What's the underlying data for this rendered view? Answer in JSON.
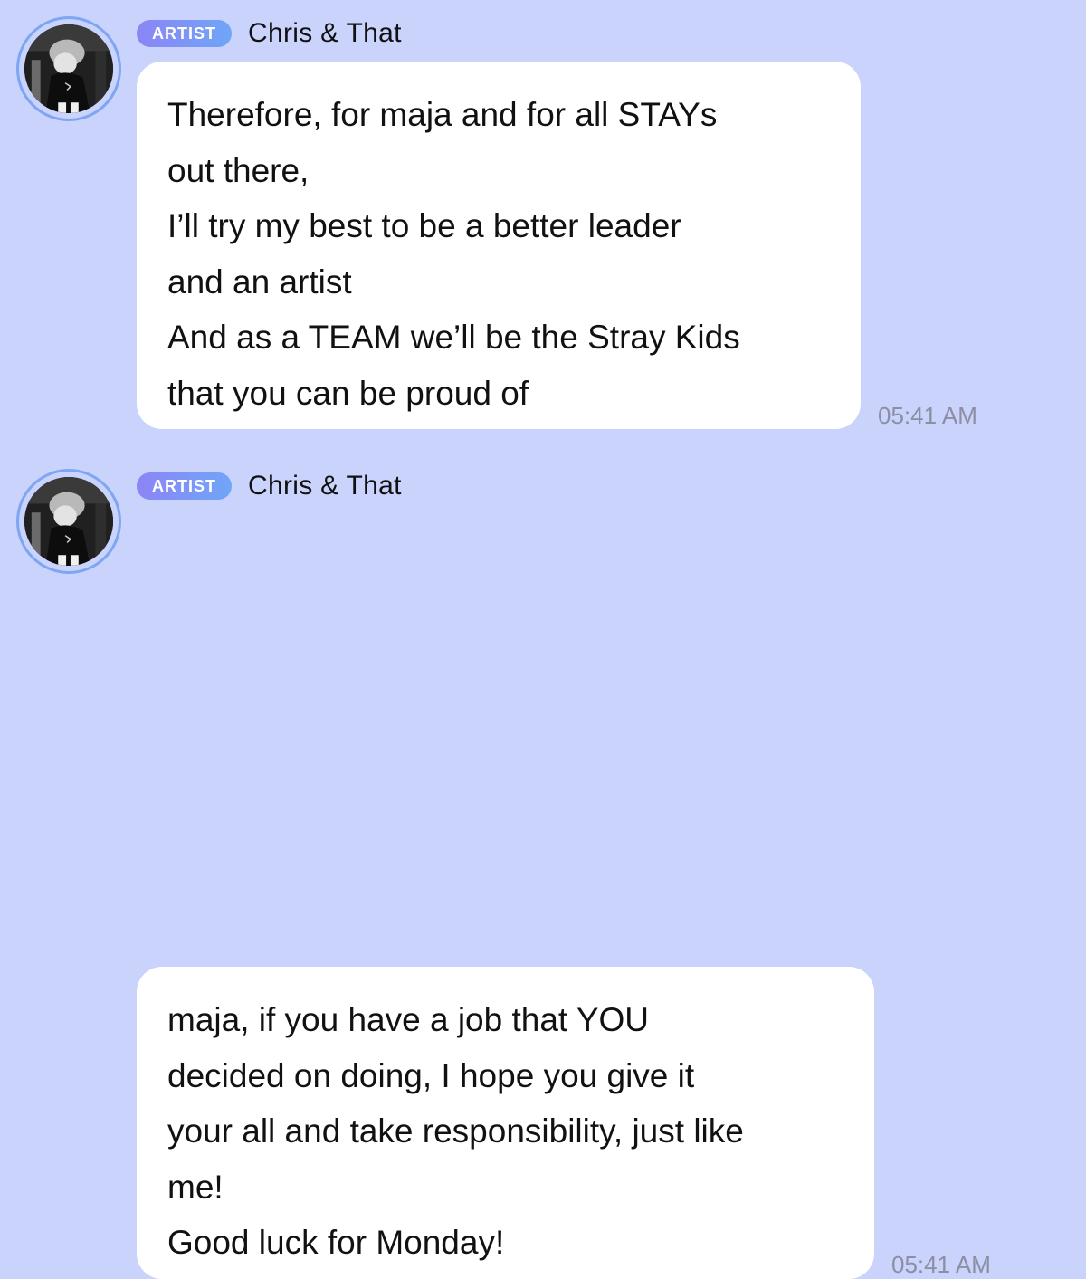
{
  "messages": [
    {
      "badge": "ARTIST",
      "sender": "Chris & That",
      "lines": [
        "Therefore, for maja and for all STAYs",
        "out there,",
        "I’ll try my best to be a better leader",
        "and an artist",
        "And as a TEAM we’ll be the Stray Kids",
        "that you can be proud of"
      ],
      "time": "05:41 AM"
    },
    {
      "badge": "ARTIST",
      "sender": "Chris & That",
      "lines": [
        "maja, if you have a job that YOU",
        "decided on doing, I hope you give it",
        "your all and take responsibility, just like",
        "me!",
        "Good luck for Monday!"
      ],
      "time": "05:41 AM"
    }
  ],
  "colors": {
    "background": "#c9d3fb",
    "badge_gradient_start": "#8d84f6",
    "badge_gradient_end": "#6fa6f7",
    "avatar_ring": "#7fa6f3",
    "timestamp": "#8b8fa3"
  }
}
